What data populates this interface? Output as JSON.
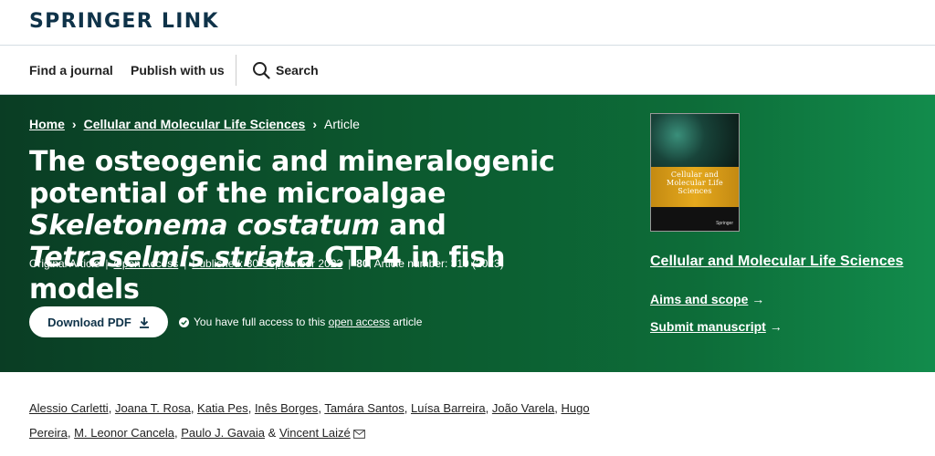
{
  "brand": {
    "logo": "Springer Link"
  },
  "nav": {
    "find_journal": "Find a journal",
    "publish": "Publish with us",
    "search": "Search"
  },
  "breadcrumb": {
    "home": "Home",
    "journal": "Cellular and Molecular Life Sciences",
    "current": "Article"
  },
  "article": {
    "title_part1": "The osteogenic and mineralogenic potential of the microalgae ",
    "title_italic1": "Skeletonema costatum",
    "title_part2": " and ",
    "title_italic2": "Tetraselmis striata",
    "title_part3": " CTP4 in fish models",
    "type": "Original Article",
    "open_access": "Open Access",
    "published": "Published: 30 September 2023",
    "volume": "80",
    "article_number": ", Article number: 310 (2023)",
    "download_pdf": "Download PDF",
    "access_text1": "You have full access to this ",
    "access_link": "open access",
    "access_text2": " article"
  },
  "journal": {
    "cover_title": "Cellular and Molecular Life Sciences",
    "cover_publisher": "Springer",
    "name": "Cellular and Molecular Life Sciences",
    "aims": "Aims and scope",
    "submit": "Submit manuscript",
    "arrow": "→"
  },
  "authors": [
    "Alessio Carletti",
    "Joana T. Rosa",
    "Katia Pes",
    "Inês Borges",
    "Tamára Santos",
    "Luísa Barreira",
    "João Varela",
    "Hugo Pereira",
    "M. Leonor Cancela",
    "Paulo J. Gavaia",
    "Vincent Laizé"
  ],
  "author_and": "&",
  "colors": {
    "hero_start": "#0a3d24",
    "hero_end": "#128c4c",
    "brand": "#0f3349"
  }
}
